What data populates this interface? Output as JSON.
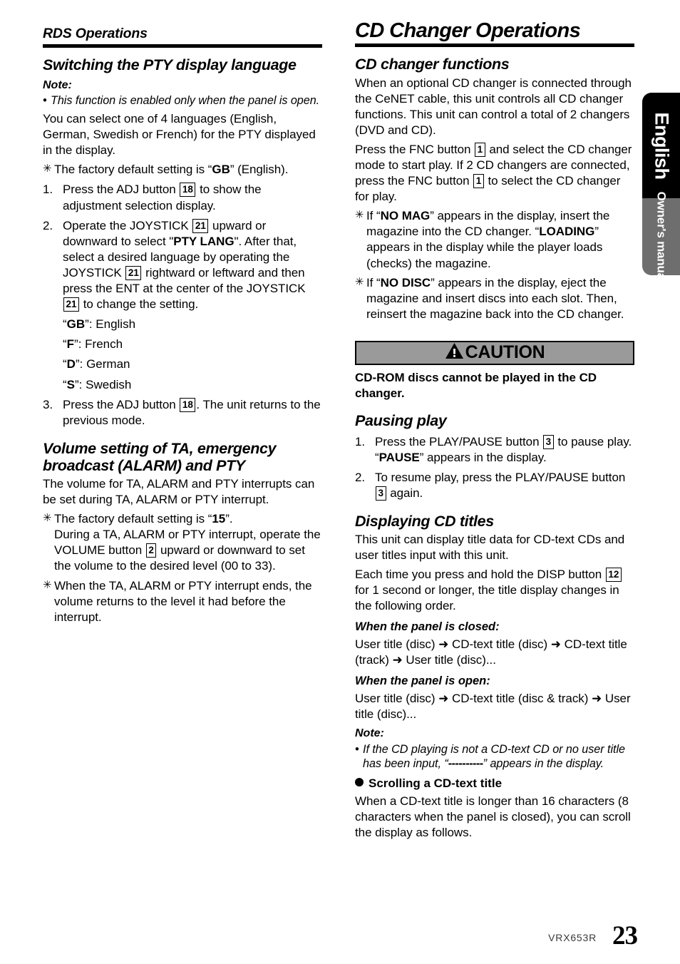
{
  "left_column": {
    "running_head": "RDS Operations",
    "section1": {
      "title": "Switching the PTY display language",
      "note_label": "Note:",
      "note_bullet": "This function is enabled only when the panel is open.",
      "intro": "You can select one of 4 languages (English, German, Swedish or French) for the PTY displayed in the display.",
      "star1_pre": "The factory default setting is “",
      "star1_bold": "GB",
      "star1_post": "” (English).",
      "step1_num": "1.",
      "step1_a": "Press the ADJ button",
      "step1_btn": "18",
      "step1_b": "to show the adjustment selection display.",
      "step2_num": "2.",
      "step2_a": "Operate the JOYSTICK",
      "step2_btn1": "21",
      "step2_b": "upward or downward to select \"",
      "step2_bold": "PTY LANG",
      "step2_c": "\". After that, select a desired language by operating the JOYSTICK",
      "step2_btn2": "21",
      "step2_d": "rightward or leftward and then press the ENT at the center of the JOYSTICK",
      "step2_btn3": "21",
      "step2_e": "to change the setting.",
      "langs": [
        {
          "code": "GB",
          "name": "English"
        },
        {
          "code": "F",
          "name": "French"
        },
        {
          "code": "D",
          "name": "German"
        },
        {
          "code": "S",
          "name": "Swedish"
        }
      ],
      "step3_num": "3.",
      "step3_a": "Press the ADJ button",
      "step3_btn": "18",
      "step3_b": ". The unit returns to the previous mode."
    },
    "section2": {
      "title": "Volume setting of TA, emergency broadcast (ALARM) and PTY",
      "intro": "The volume for TA, ALARM and PTY interrupts can be set during TA, ALARM or PTY interrupt.",
      "star1_pre": "The factory default setting is “",
      "star1_bold": "15",
      "star1_post": "”.",
      "star1_cont_a": "During a TA, ALARM or PTY interrupt, operate the VOLUME button",
      "star1_btn": "2",
      "star1_cont_b": "upward or downward to set the volume to the desired level (00 to 33).",
      "star2": "When the TA, ALARM or PTY interrupt ends, the volume returns to the level it had before the interrupt."
    }
  },
  "right_column": {
    "chapter_head": "CD Changer Operations",
    "section1": {
      "title": "CD changer functions",
      "para1": "When an optional CD changer is connected through the CeNET cable, this unit controls all CD changer functions. This unit can control a total of 2 changers (DVD and CD).",
      "para2_a": "Press the FNC button",
      "para2_btn1": "1",
      "para2_b": "and select the CD changer mode to start play. If 2 CD changers are connected, press the FNC button",
      "para2_btn2": "1",
      "para2_c": "to select the CD changer for play.",
      "star1_pre": "If “",
      "star1_bold1": "NO MAG",
      "star1_mid": "” appears in the display, insert the magazine into the CD changer. “",
      "star1_bold2": "LOADING",
      "star1_post": "” appears in the display while the player loads (checks) the magazine.",
      "star2_pre": "If “",
      "star2_bold": "NO DISC",
      "star2_post": "” appears in the display, eject the magazine and insert discs into each slot. Then, reinsert the magazine back into the CD changer."
    },
    "caution": {
      "label": "CAUTION",
      "icon": "warning-triangle-icon",
      "text": "CD-ROM discs cannot be played in the CD changer.",
      "background_color": "#9a9a9a"
    },
    "section2": {
      "title": "Pausing play",
      "step1_num": "1.",
      "step1_a": "Press the PLAY/PAUSE button",
      "step1_btn": "3",
      "step1_b": "to pause play. “",
      "step1_bold": "PAUSE",
      "step1_c": "” appears in the display.",
      "step2_num": "2.",
      "step2_a": "To resume play, press the PLAY/PAUSE button",
      "step2_btn": "3",
      "step2_b": "again."
    },
    "section3": {
      "title": "Displaying CD titles",
      "para1": "This unit can display title data for CD-text CDs and user titles input with this unit.",
      "para2_a": "Each time you press and hold the DISP button",
      "para2_btn": "12",
      "para2_b": "for 1 second or longer, the title display changes in the following order.",
      "closed_head": "When the panel is closed:",
      "closed_flow": "User title (disc) ➜ CD-text title (disc) ➜ CD-text title (track) ➜ User title (disc)...",
      "open_head": "When the panel is open:",
      "open_flow": "User title (disc) ➜ CD-text title (disc & track) ➜ User title (disc)...",
      "note_label": "Note:",
      "note_pre": "If the CD playing is not a CD-text CD or no user title has been input, “",
      "note_dashes": "----------",
      "note_post": "” appears in the display.",
      "scroll_head": "Scrolling a CD-text title",
      "scroll_para": "When a CD-text title is longer than 16 characters (8 characters when the panel is closed), you can scroll the display as follows."
    }
  },
  "side_tab": {
    "language": "English",
    "manual_label": "Owner's manual"
  },
  "footer": {
    "model": "VRX653R",
    "page_number": "23"
  }
}
